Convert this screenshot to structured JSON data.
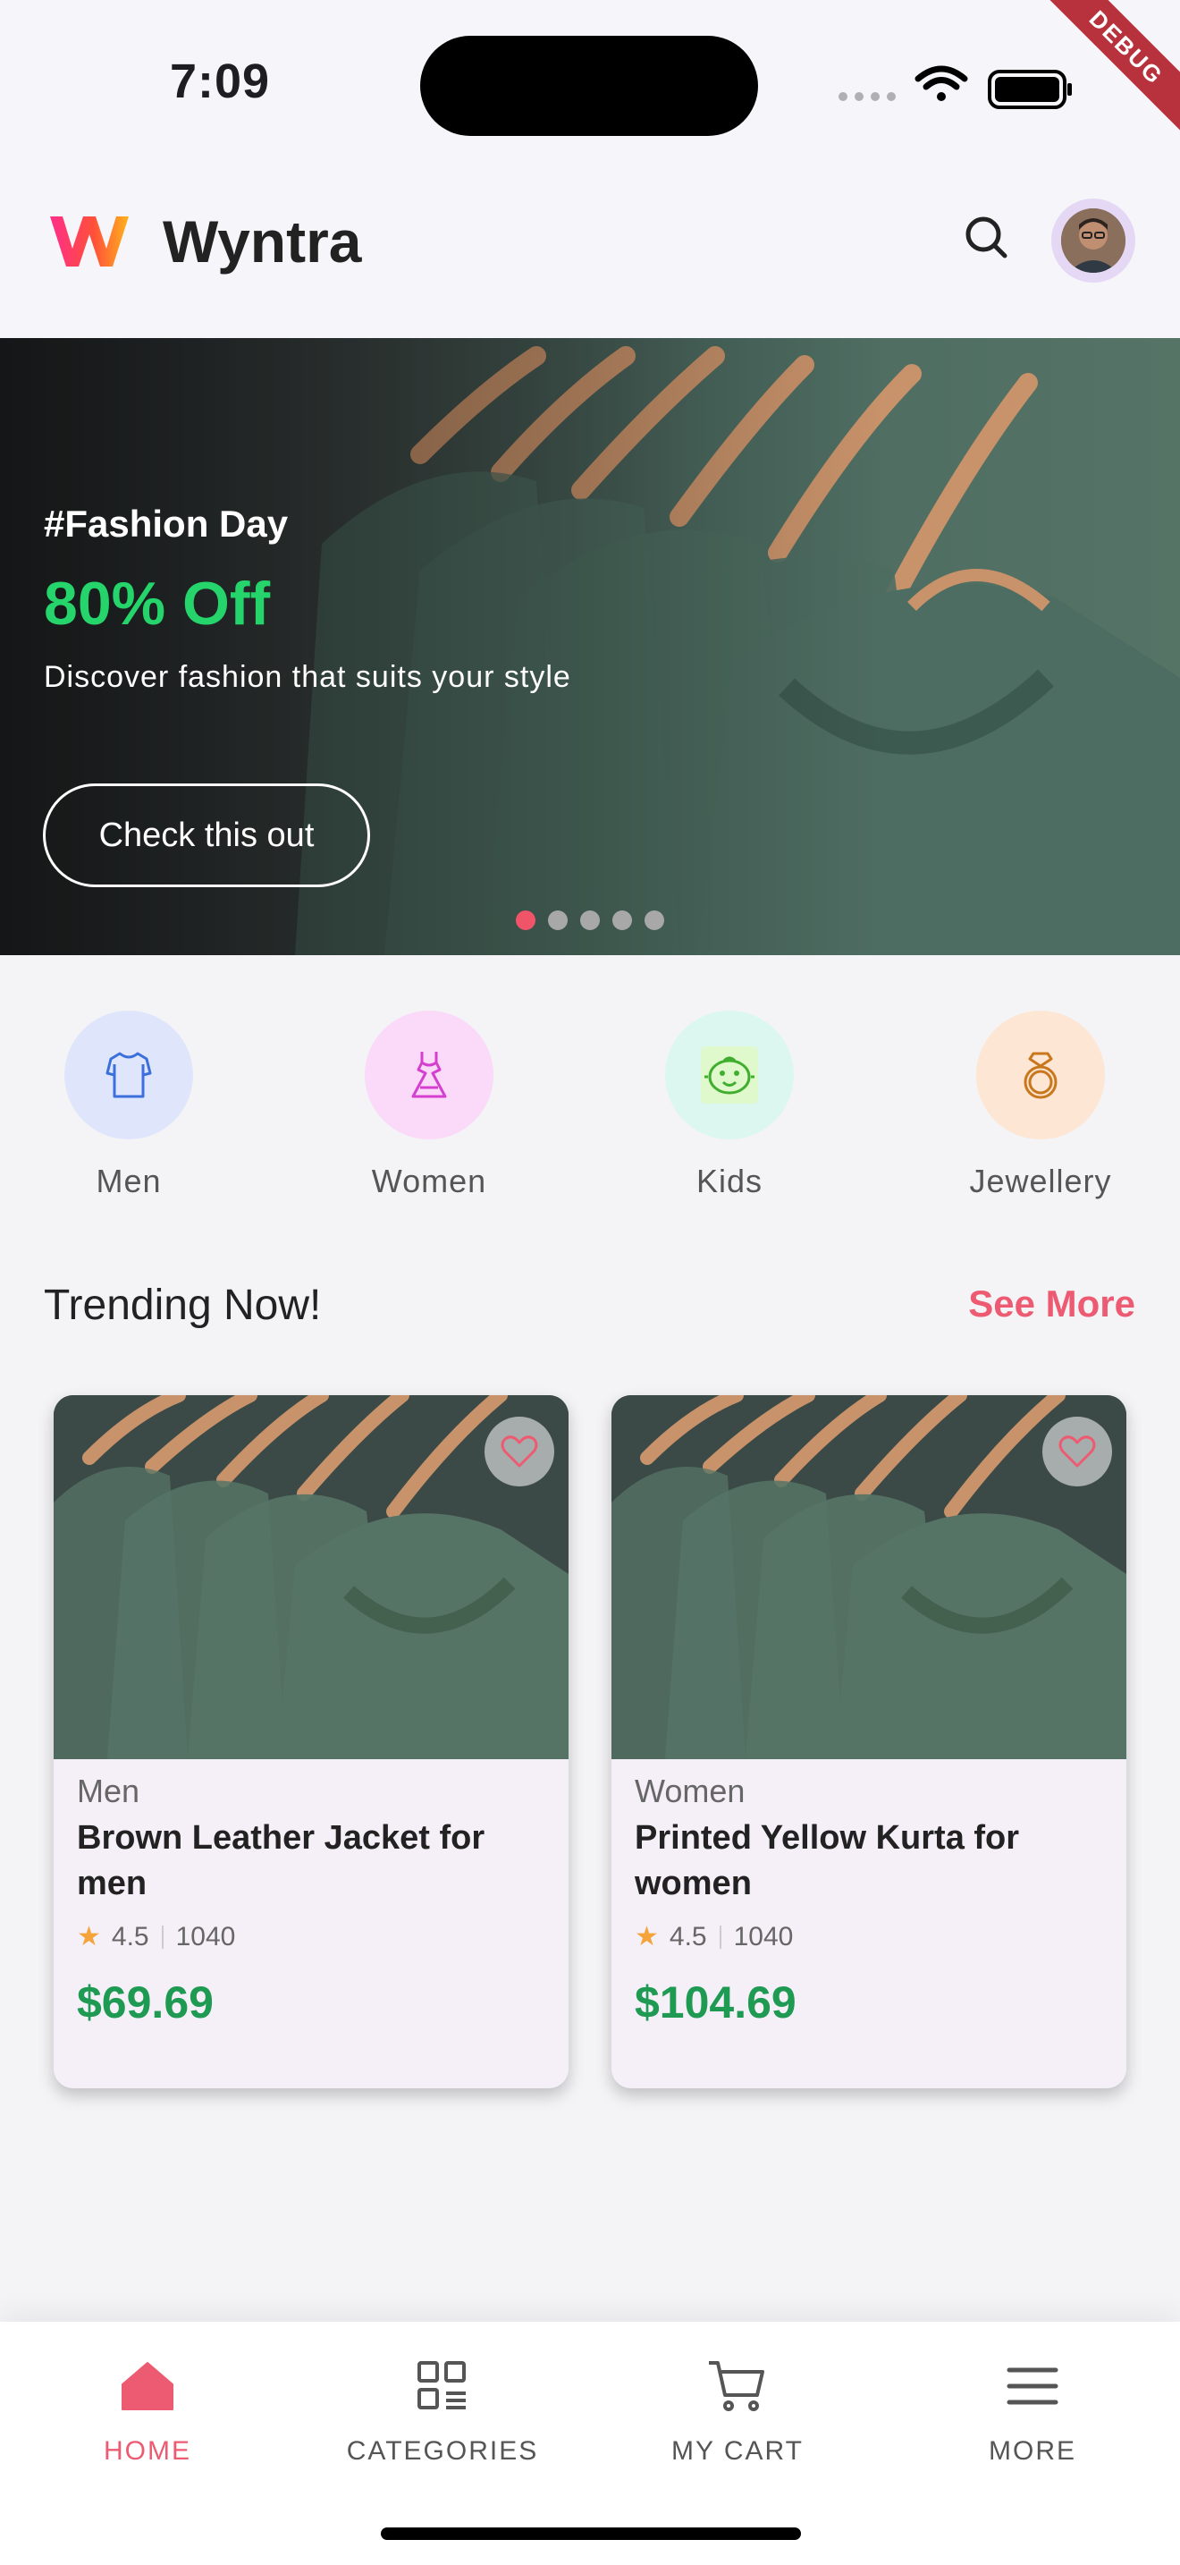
{
  "status_bar": {
    "time": "7:09",
    "debug_label": "DEBUG"
  },
  "app_bar": {
    "brand": "Wyntra"
  },
  "banner": {
    "tag": "#Fashion Day",
    "offer": "80% Off",
    "description": "Discover fashion that suits your style",
    "cta": "Check this out",
    "slide_count": 5,
    "active_slide": 1
  },
  "categories": [
    {
      "label": "Men",
      "icon": "shirt-icon",
      "bg": "#dfe6fb",
      "color": "#3b6fdc"
    },
    {
      "label": "Women",
      "icon": "dress-icon",
      "bg": "#fbd9f8",
      "color": "#d43fd0"
    },
    {
      "label": "Kids",
      "icon": "baby-icon",
      "bg": "#dbf7ef",
      "color": "#3fae2f"
    },
    {
      "label": "Jewellery",
      "icon": "ring-icon",
      "bg": "#fde6d4",
      "color": "#c9771d"
    }
  ],
  "trending": {
    "title": "Trending Now!",
    "see_more": "See More",
    "products": [
      {
        "category": "Men",
        "name": "Brown Leather Jacket for men",
        "rating": "4.5",
        "reviews": "1040",
        "price": "$69.69"
      },
      {
        "category": "Women",
        "name": "Printed Yellow Kurta for women",
        "rating": "4.5",
        "reviews": "1040",
        "price": "$104.69"
      }
    ]
  },
  "bottom_nav": {
    "items": [
      {
        "label": "HOME",
        "icon": "home-icon",
        "active": true
      },
      {
        "label": "CATEGORIES",
        "icon": "grid-icon",
        "active": false
      },
      {
        "label": "MY CART",
        "icon": "cart-icon",
        "active": false
      },
      {
        "label": "MORE",
        "icon": "menu-icon",
        "active": false
      }
    ]
  },
  "colors": {
    "accent": "#ec5b71",
    "offer_green": "#25d46a",
    "price_green": "#1e9a53",
    "rating_star": "#f4a43a"
  }
}
